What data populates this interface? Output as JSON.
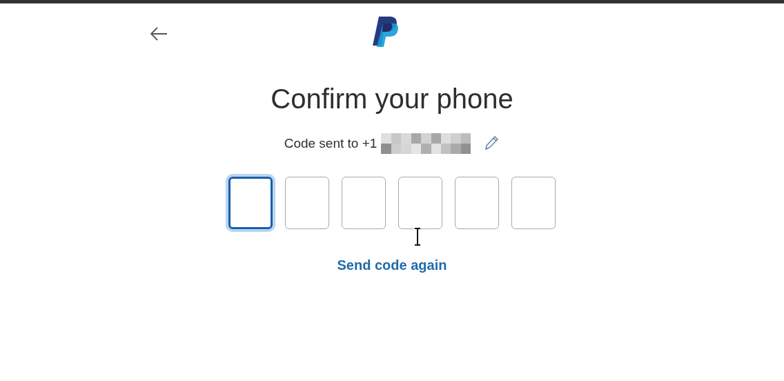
{
  "title": "Confirm your phone",
  "code_sent": "Code sent to +1",
  "code_fields": [
    {
      "selected": true
    },
    {
      "selected": false
    },
    {
      "selected": false
    },
    {
      "selected": false
    },
    {
      "selected": false
    },
    {
      "selected": false
    }
  ],
  "resend_link": "Send code again"
}
